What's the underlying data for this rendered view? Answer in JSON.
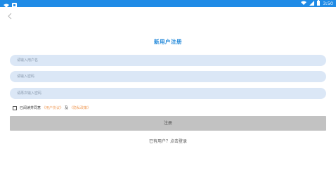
{
  "status_bar": {
    "time": "3:50",
    "colors": {
      "background": "#1f8be6"
    },
    "icons": [
      "wifi-small-icon",
      "notification-square-icon",
      "wifi-icon",
      "signal-icon",
      "battery-icon"
    ]
  },
  "page": {
    "title": "新用户注册",
    "back_icon": "chevron-left-icon",
    "accent_color": "#1e86d9"
  },
  "form": {
    "username_placeholder": "请输入用户名",
    "password_placeholder": "请输入密码",
    "confirm_placeholder": "请再次输入密码",
    "agreement": {
      "checked": false,
      "prefix": "已阅读并同意",
      "user_agreement": "《用户协议》",
      "and": "及",
      "privacy_policy": "《隐私政策》"
    },
    "register_button": "注册",
    "login_link": "已有用户？点击登录"
  }
}
